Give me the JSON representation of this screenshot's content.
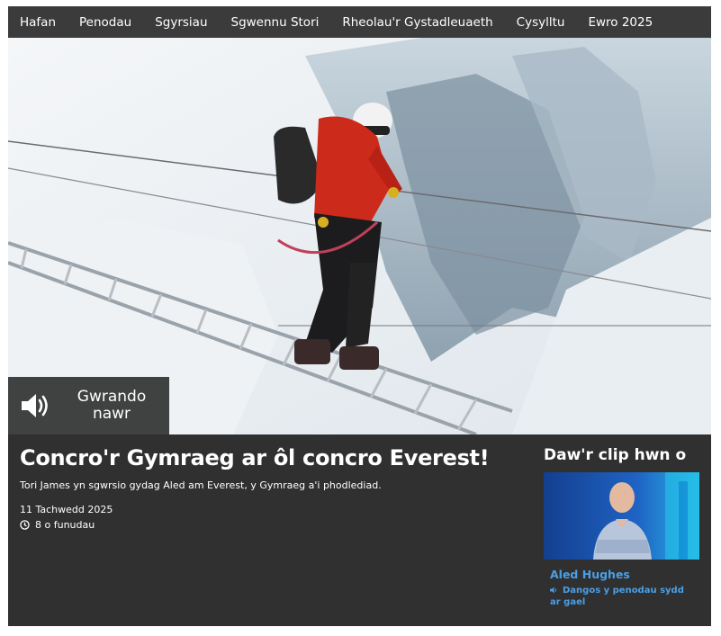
{
  "nav": {
    "items": [
      {
        "label": "Hafan"
      },
      {
        "label": "Penodau"
      },
      {
        "label": "Sgyrsiau"
      },
      {
        "label": "Sgwennu Stori"
      },
      {
        "label": "Rheolau'r Gystadleuaeth"
      },
      {
        "label": "Cysylltu"
      },
      {
        "label": "Ewro 2025"
      }
    ]
  },
  "hero": {
    "image": "climber-crossing-ladder-over-crevasse",
    "listen_button": {
      "label_line1": "Gwrando",
      "label_line2": "nawr",
      "icon": "speaker-icon"
    }
  },
  "episode": {
    "title": "Concro'r Gymraeg ar ôl concro Everest!",
    "summary": "Tori James yn sgwrsio gydag Aled am Everest, y Gymraeg a'i phodlediad.",
    "date": "11 Tachwedd 2025",
    "duration": "8 o funudau",
    "duration_icon": "clock-icon"
  },
  "sidebar": {
    "heading": "Daw'r clip hwn o",
    "presenter": "Aled Hughes",
    "episodes_link": "Dangos y penodau sydd ar gael",
    "link_icon": "speaker-small-icon"
  },
  "colors": {
    "nav_bg": "#3b3b3b",
    "panel_bg": "#303030",
    "link": "#4a9fe8",
    "thumb_bg": "#1e4fa8"
  }
}
